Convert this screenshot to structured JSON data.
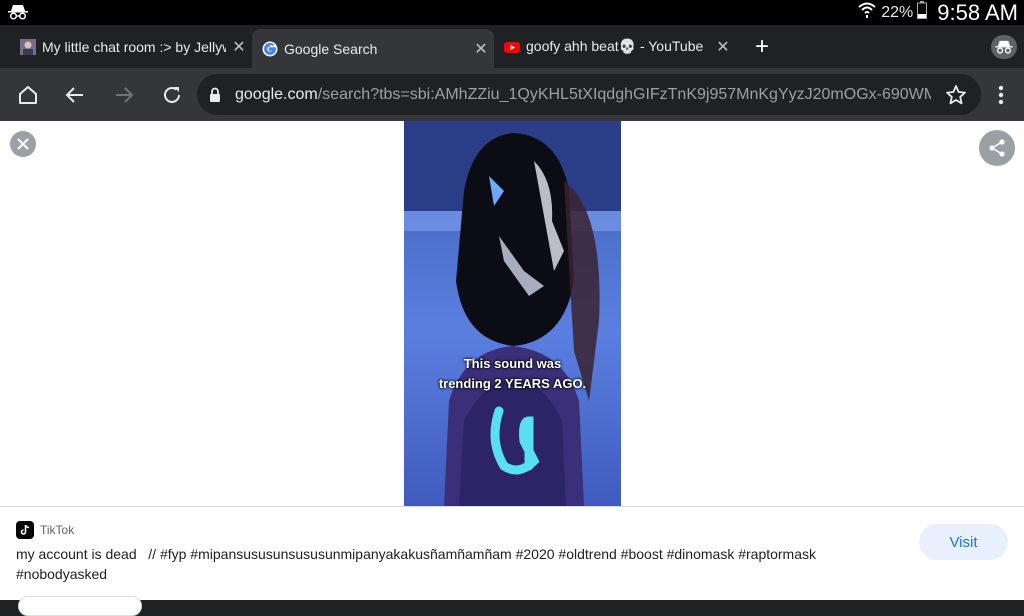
{
  "status": {
    "battery": "22%",
    "time": "9:58 AM"
  },
  "tabs": [
    {
      "title": "My little chat room :> by Jellyw",
      "favicon": "user-avatar-icon"
    },
    {
      "title": "Google Search",
      "favicon": "google-icon",
      "active": true
    },
    {
      "title": "goofy ahh beat💀 - YouTube",
      "favicon": "youtube-icon"
    }
  ],
  "toolbar": {
    "url_host": "google.com",
    "url_path": "/search?tbs=sbi:AMhZZiu_1QyKHL5tXIqdghGIFzTnK9j957MnKgYyzJ20mOGx-690WM"
  },
  "preview": {
    "subtitle_line1": "This sound was",
    "subtitle_line2": "trending 2 YEARS AGO."
  },
  "result": {
    "source": "TikTok",
    "caption": "my account is dead   // #fyp #mipansususunsususunmipanyakakusñamñamñam #2020 #oldtrend #boost #dinomask #raptormask #nobodyasked",
    "visit_label": "Visit"
  },
  "colors": {
    "accent": "#1a73e8",
    "chrome_dark": "#35363a"
  }
}
